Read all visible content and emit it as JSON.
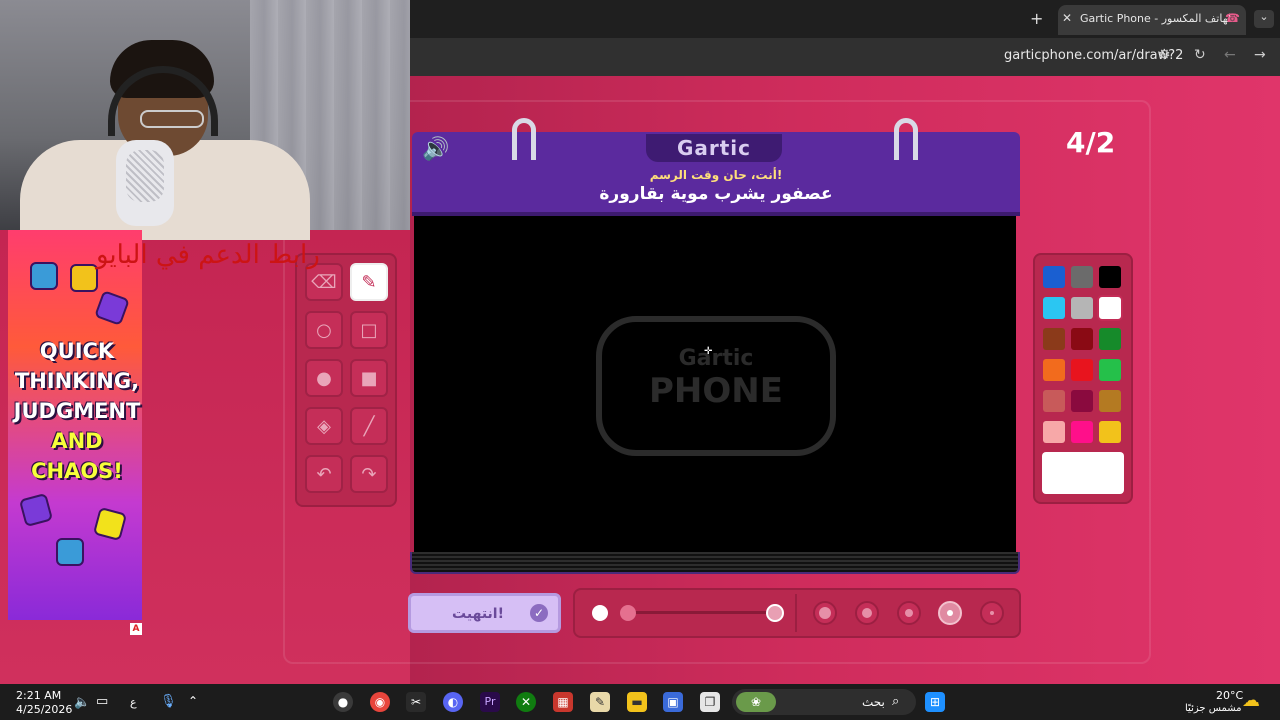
{
  "browser": {
    "tab_title": "Gartic Phone - الهاتف المكسور",
    "url": "garticphone.com/ar/draw?2",
    "new_tab_glyph": "+",
    "close_glyph": "✕"
  },
  "game": {
    "logo": "Gartic",
    "prompt_sub": "أنت، حان وقت الرسم!",
    "prompt_main": "عصفور يشرب موية بقارورة",
    "counter": "4/2",
    "watermark_top": "Gartic",
    "watermark_bottom": "PHONE",
    "done_label": "انتهيت!",
    "tools": [
      {
        "name": "eraser-tool",
        "icon": "eraser-icon",
        "glyph": "⌫"
      },
      {
        "name": "pencil-tool",
        "icon": "pencil-icon",
        "glyph": "✎",
        "active": true
      },
      {
        "name": "ellipse-outline-tool",
        "icon": "circle-outline-icon",
        "glyph": "○"
      },
      {
        "name": "rectangle-outline-tool",
        "icon": "square-outline-icon",
        "glyph": "□"
      },
      {
        "name": "ellipse-filled-tool",
        "icon": "circle-filled-icon",
        "glyph": "●"
      },
      {
        "name": "rectangle-filled-tool",
        "icon": "square-filled-icon",
        "glyph": "■"
      },
      {
        "name": "fill-tool",
        "icon": "bucket-icon",
        "glyph": "◈"
      },
      {
        "name": "line-tool",
        "icon": "line-icon",
        "glyph": "╱"
      },
      {
        "name": "undo-tool",
        "icon": "undo-icon",
        "glyph": "↶"
      },
      {
        "name": "redo-tool",
        "icon": "redo-icon",
        "glyph": "↷"
      }
    ],
    "palette": [
      "#1a5fd1",
      "#6b6b6b",
      "#000000",
      "#2bc6f2",
      "#b5b5b5",
      "#ffffff",
      "#8b3a1a",
      "#8a0a14",
      "#168a2a",
      "#f26b1d",
      "#e8141e",
      "#25c04a",
      "#c85a5a",
      "#8a0a3e",
      "#b47a22",
      "#f7a8a8",
      "#ff0f8a",
      "#f2c21b"
    ],
    "selected_color": "#ffffff",
    "opacity_level": 1.0
  },
  "overlay": {
    "support_text": "رابط الدعم في البايو"
  },
  "ad": {
    "line1": "QUICK",
    "line2": "THINKING,",
    "line3": "JUDGMENT",
    "line4": "AND",
    "line5": "CHAOS!",
    "badge": "A"
  },
  "taskbar": {
    "time": "2:21 AM",
    "date": "4/25/2026",
    "lang": "ع",
    "search_label": "بحث",
    "weather_temp": "20°C",
    "weather_desc": "مشمس جزئيًا"
  }
}
